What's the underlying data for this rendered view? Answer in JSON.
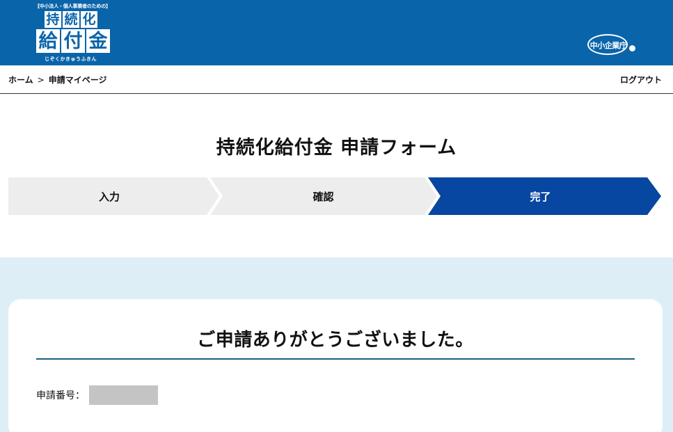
{
  "header": {
    "logo": {
      "tagline": "【中小法人・個人事業者のための】",
      "row1": [
        "持",
        "続",
        "化"
      ],
      "row2": [
        "給",
        "付",
        "金"
      ],
      "ruby": "じぞくかきゅうふきん"
    },
    "agency_logo": "中小企業庁",
    "colors": {
      "header_bg": "#0a64a9",
      "step_active": "#0747a1",
      "step_inactive": "#ededed",
      "section_bg": "#ddeef7",
      "divider": "#1c5f80"
    }
  },
  "breadcrumb": {
    "home": "ホーム",
    "separator": ">",
    "current": "申請マイページ"
  },
  "logout_label": "ログアウト",
  "page_title": "持続化給付金 申請フォーム",
  "steps": [
    {
      "label": "入力",
      "active": false
    },
    {
      "label": "確認",
      "active": false
    },
    {
      "label": "完了",
      "active": true
    }
  ],
  "completion": {
    "heading": "ご申請ありがとうございました。",
    "application_number_label": "申請番号："
  }
}
